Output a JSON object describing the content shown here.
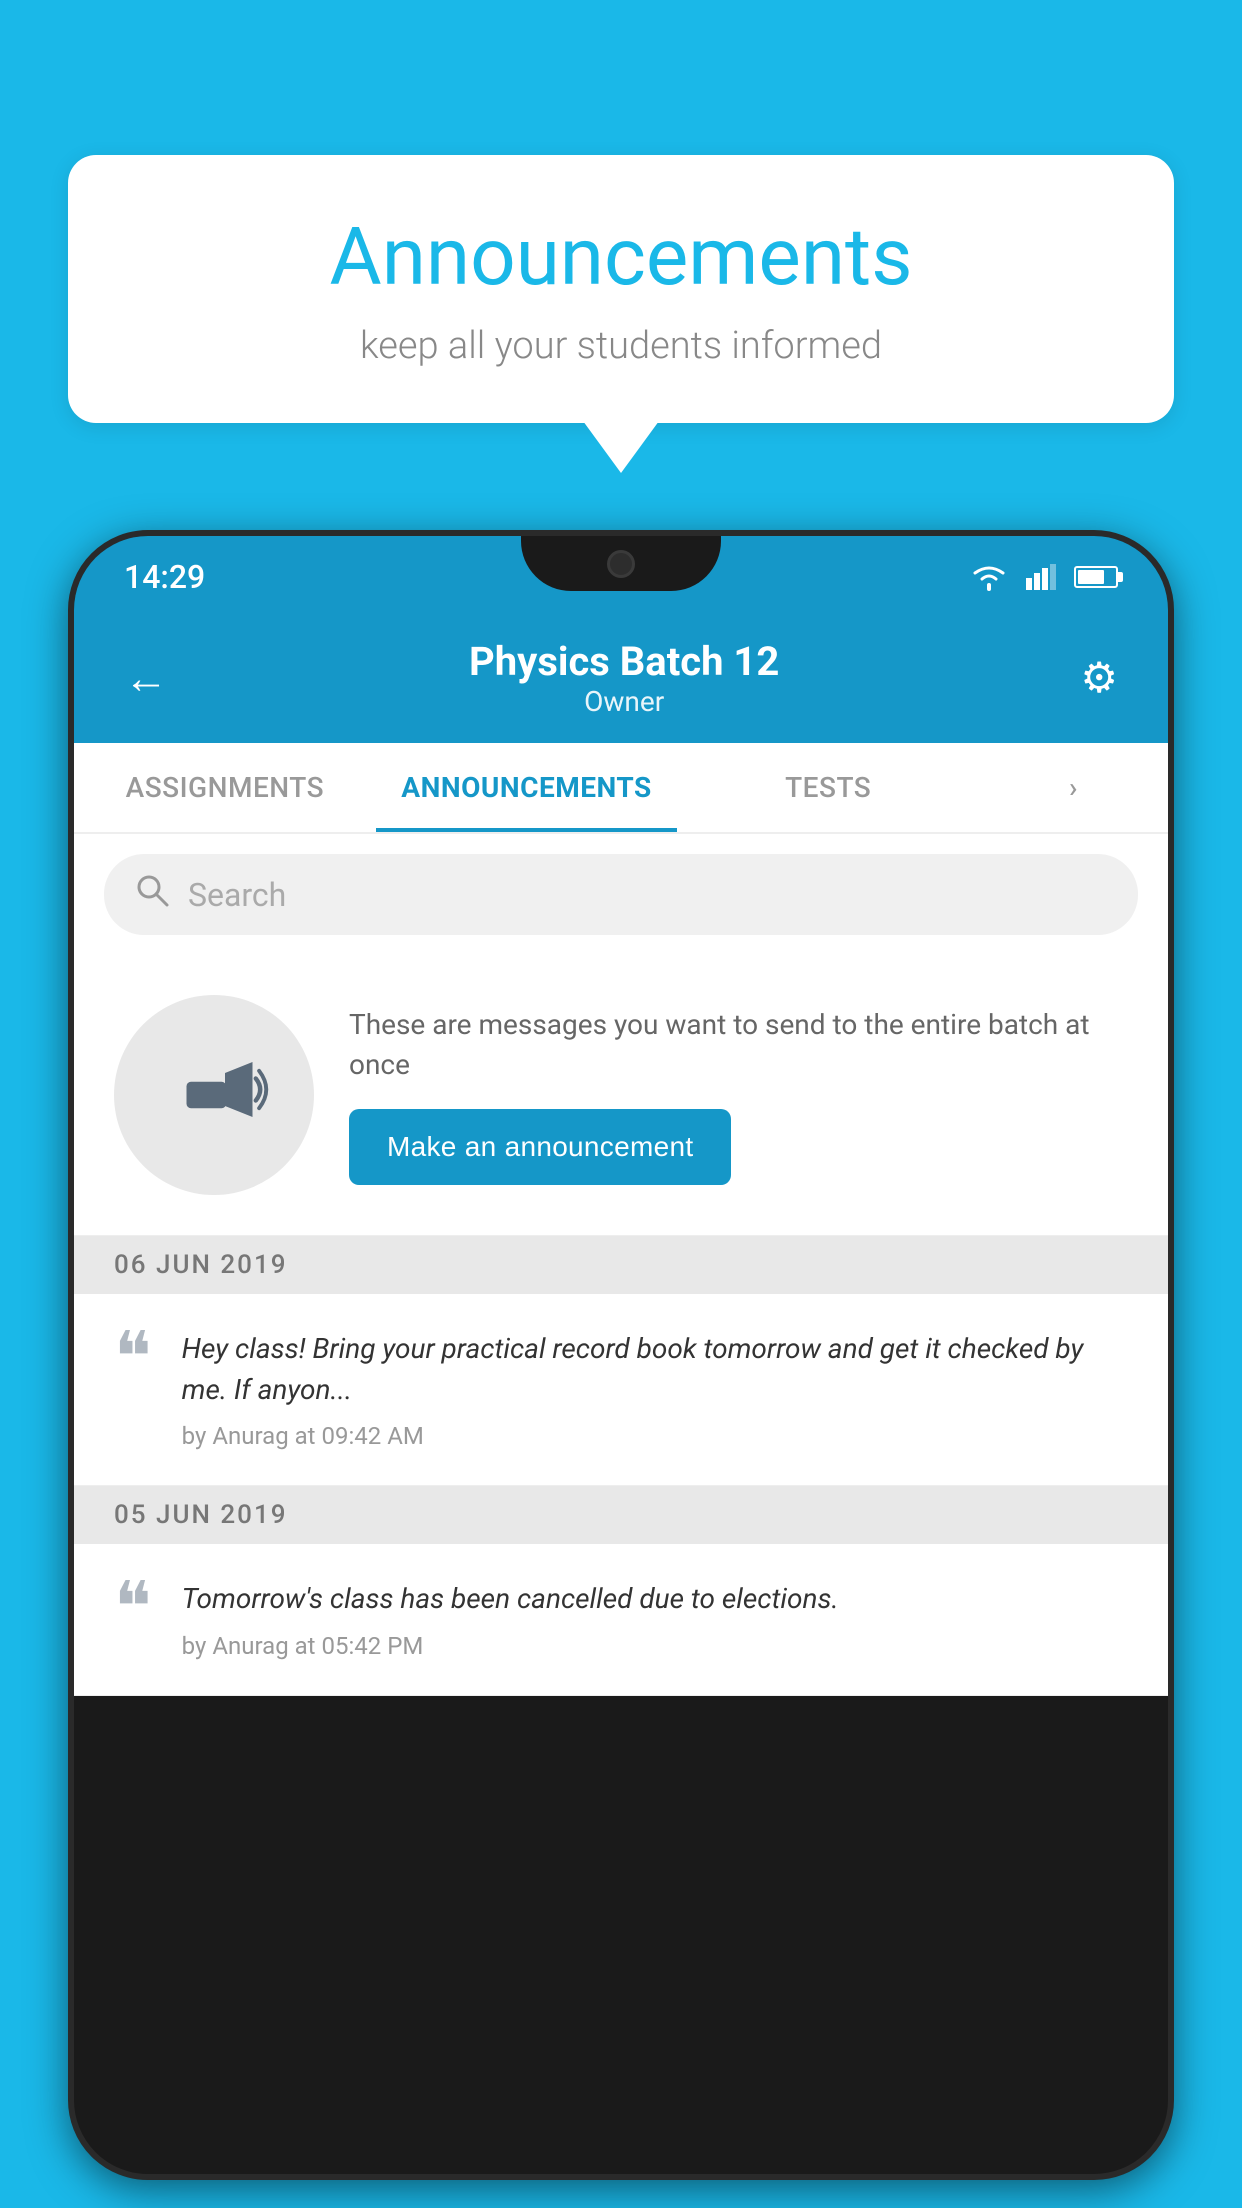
{
  "background_color": "#1ab8e8",
  "speech_bubble": {
    "title": "Announcements",
    "subtitle": "keep all your students informed"
  },
  "phone": {
    "status_bar": {
      "time": "14:29"
    },
    "header": {
      "title": "Physics Batch 12",
      "subtitle": "Owner",
      "back_label": "←",
      "settings_label": "⚙"
    },
    "tabs": [
      {
        "label": "ASSIGNMENTS",
        "active": false
      },
      {
        "label": "ANNOUNCEMENTS",
        "active": true
      },
      {
        "label": "TESTS",
        "active": false
      },
      {
        "label": "›",
        "active": false,
        "partial": true
      }
    ],
    "search": {
      "placeholder": "Search"
    },
    "cta": {
      "description": "These are messages you want to send to the entire batch at once",
      "button_label": "Make an announcement"
    },
    "announcements": [
      {
        "date": "06  JUN  2019",
        "items": [
          {
            "body": "Hey class! Bring your practical record book tomorrow and get it checked by me. If anyon...",
            "meta": "by Anurag at 09:42 AM"
          }
        ]
      },
      {
        "date": "05  JUN  2019",
        "items": [
          {
            "body": "Tomorrow's class has been cancelled due to elections.",
            "meta": "by Anurag at 05:42 PM"
          }
        ]
      }
    ]
  }
}
